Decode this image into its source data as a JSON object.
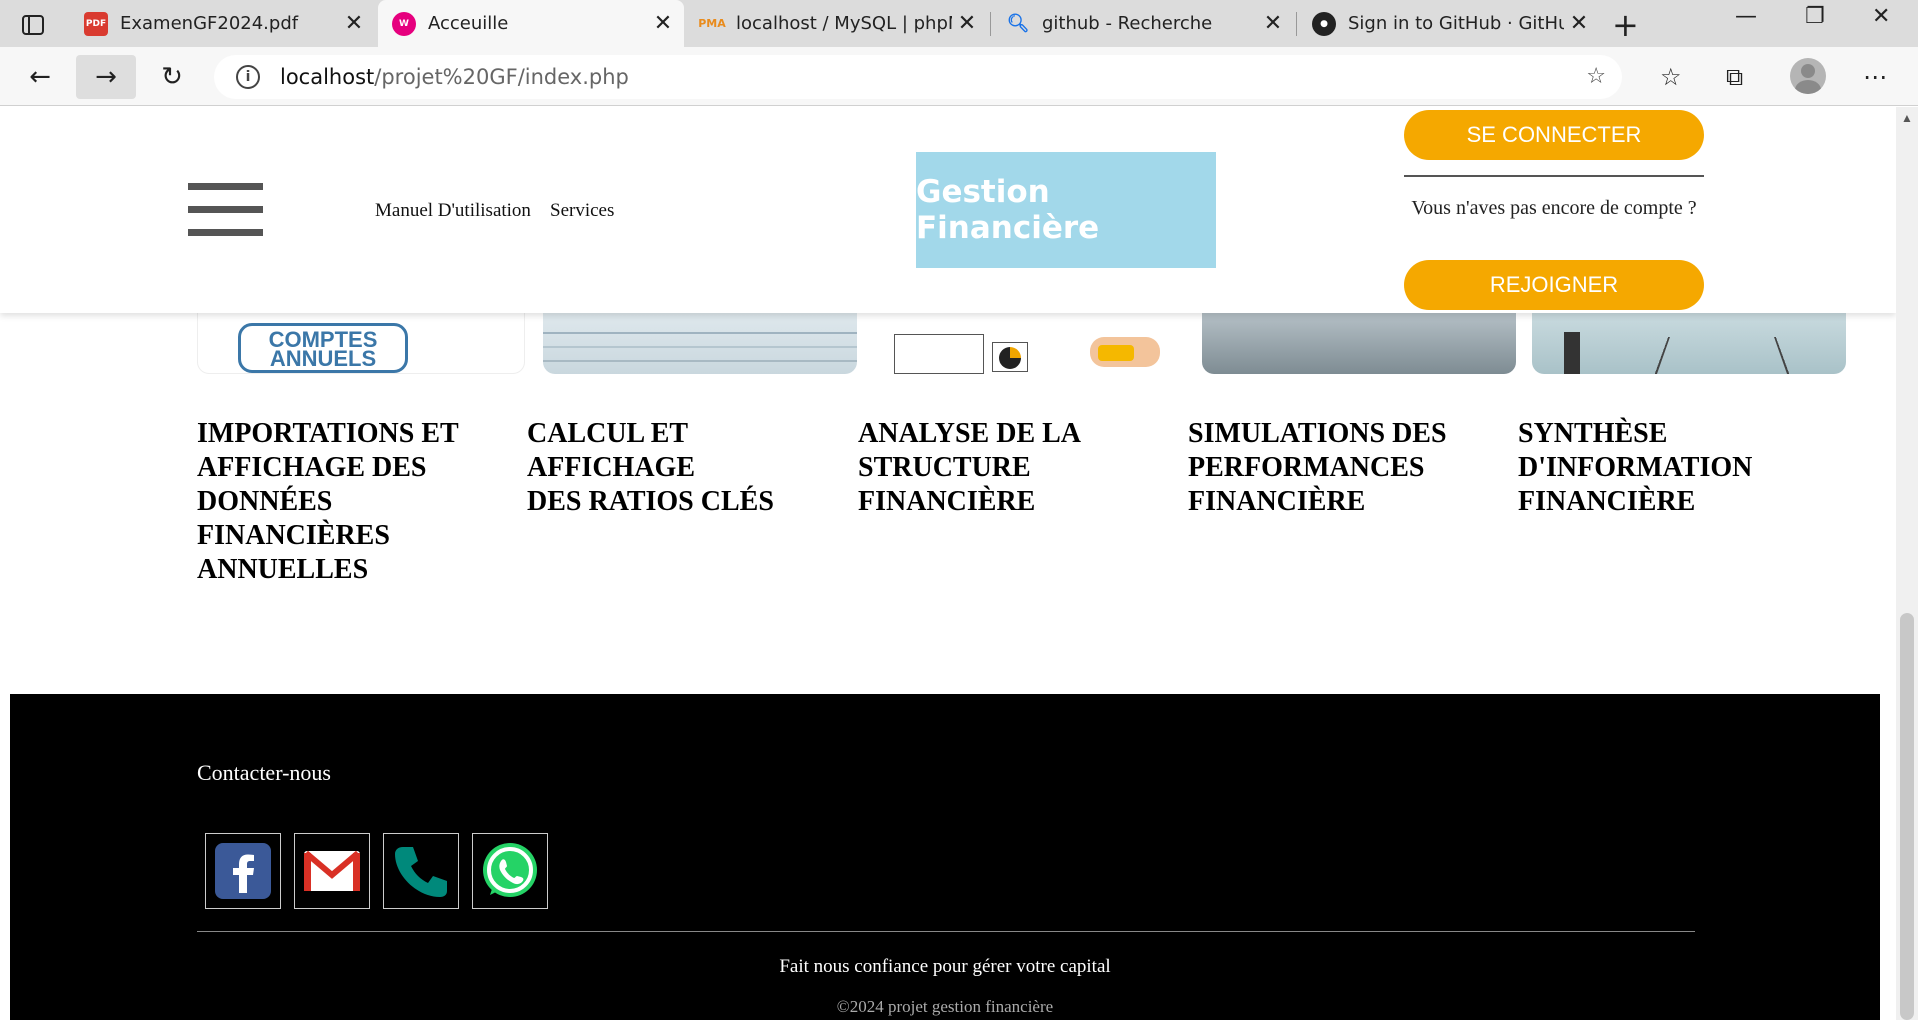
{
  "browser": {
    "tabs": [
      {
        "title": "ExamenGF2024.pdf",
        "icon": "pdf-icon",
        "active": false
      },
      {
        "title": "Acceuille",
        "icon": "wamp-icon",
        "active": true
      },
      {
        "title": "localhost / MySQL | phpMyAdmin",
        "icon": "phpmyadmin-icon",
        "active": false
      },
      {
        "title": "github - Recherche",
        "icon": "search-icon",
        "active": false
      },
      {
        "title": "Sign in to GitHub · GitHub",
        "icon": "github-icon",
        "active": false
      }
    ],
    "url_host": "localhost",
    "url_path": "/projet%20GF/index.php"
  },
  "header": {
    "nav_links": [
      "Manuel D'utilisation",
      "Services"
    ],
    "logo_text": "Gestion Financière",
    "login_label": "SE CONNECTER",
    "no_account_text": "Vous n'aves pas encore de compte ?",
    "join_label": "REJOIGNER",
    "accent_color": "#f5a800"
  },
  "cards": {
    "card1_text": "COMPTES\nANNUELS"
  },
  "features": [
    "IMPORTATIONS ET\nAFFICHAGE DES\nDONNÉES\nFINANCIÈRES\nANNUELLES",
    "CALCUL ET\nAFFICHAGE\nDES RATIOS CLÉS",
    "ANALYSE DE LA\nSTRUCTURE\nFINANCIÈRE",
    "SIMULATIONS DES\nPERFORMANCES\nFINANCIÈRE",
    "SYNTHÈSE\nD'INFORMATION\nFINANCIÈRE"
  ],
  "footer": {
    "contact_title": "Contacter-nous",
    "socials": [
      "facebook-icon",
      "gmail-icon",
      "phone-icon",
      "whatsapp-icon"
    ],
    "tagline": "Fait nous confiance pour gérer votre capital",
    "copyright": "©2024 projet gestion financière"
  }
}
